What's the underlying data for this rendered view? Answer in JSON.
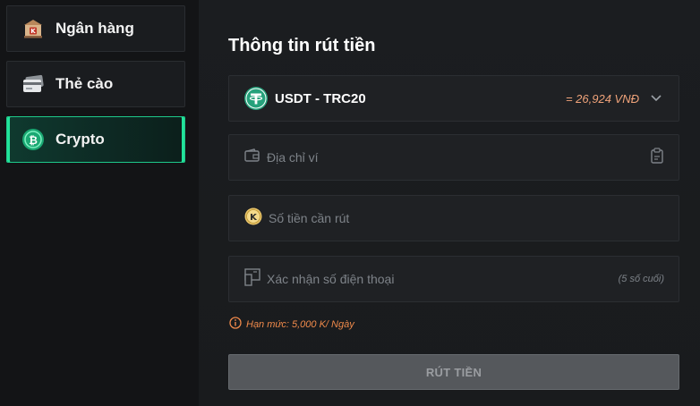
{
  "sidebar": {
    "items": [
      {
        "label": "Ngân hàng",
        "icon": "bank-icon"
      },
      {
        "label": "Thẻ cào",
        "icon": "scratch-card-icon"
      },
      {
        "label": "Crypto",
        "icon": "crypto-coin-icon",
        "active": true
      }
    ]
  },
  "main": {
    "title": "Thông tin rút tiền",
    "currency": {
      "name": "USDT - TRC20",
      "rate": "= 26,924 VNĐ",
      "icon": "tether-icon"
    },
    "wallet": {
      "placeholder": "Địa chỉ ví",
      "icon": "wallet-icon",
      "action_icon": "clipboard-icon"
    },
    "amount": {
      "placeholder": "Số tiền cần rút",
      "icon": "k-coin-icon"
    },
    "phone": {
      "placeholder": "Xác nhận số điện thoại",
      "suffix": "(5 số cuối)",
      "icon": "phone-confirm-icon"
    },
    "limit": {
      "text": "Hạn mức: 5,000 K/ Ngày",
      "icon": "info-icon"
    },
    "submit_label": "RÚT TIỀN"
  },
  "colors": {
    "accent": "#22e39b",
    "tether": "#26a17b",
    "limit_text": "#f08a4b",
    "rate_text": "#f0a37a"
  }
}
